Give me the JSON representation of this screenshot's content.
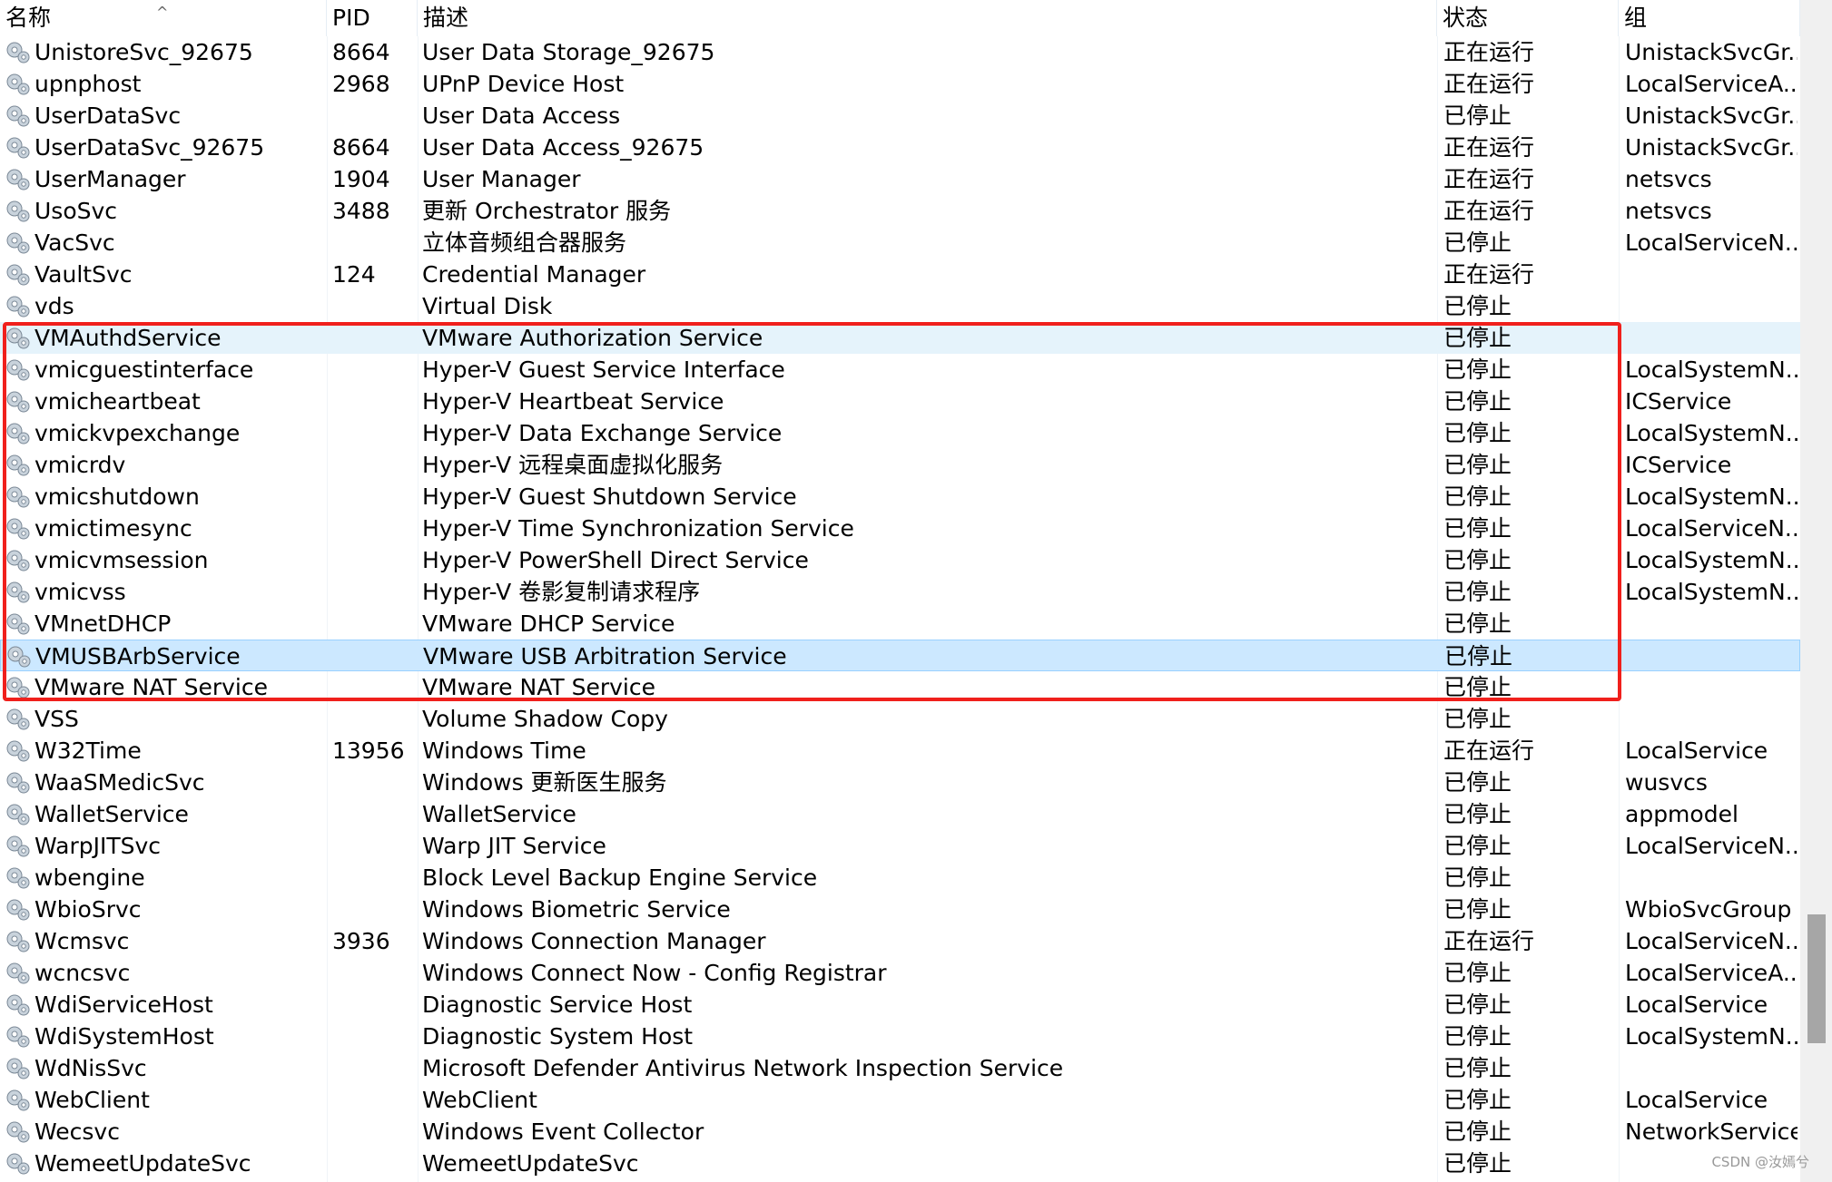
{
  "columns": {
    "name": "名称",
    "pid": "PID",
    "desc": "描述",
    "status": "状态",
    "group": "组"
  },
  "sort_indicator": "^",
  "highlight_color": "#f0201c",
  "rows": [
    {
      "name": "UnistoreSvc_92675",
      "pid": "8664",
      "desc": "User Data Storage_92675",
      "status": "正在运行",
      "group": "UnistackSvcGr..."
    },
    {
      "name": "upnphost",
      "pid": "2968",
      "desc": "UPnP Device Host",
      "status": "正在运行",
      "group": "LocalServiceA..."
    },
    {
      "name": "UserDataSvc",
      "pid": "",
      "desc": "User Data Access",
      "status": "已停止",
      "group": "UnistackSvcGr..."
    },
    {
      "name": "UserDataSvc_92675",
      "pid": "8664",
      "desc": "User Data Access_92675",
      "status": "正在运行",
      "group": "UnistackSvcGr..."
    },
    {
      "name": "UserManager",
      "pid": "1904",
      "desc": "User Manager",
      "status": "正在运行",
      "group": "netsvcs"
    },
    {
      "name": "UsoSvc",
      "pid": "3488",
      "desc": "更新 Orchestrator 服务",
      "status": "正在运行",
      "group": "netsvcs"
    },
    {
      "name": "VacSvc",
      "pid": "",
      "desc": "立体音频组合器服务",
      "status": "已停止",
      "group": "LocalServiceN..."
    },
    {
      "name": "VaultSvc",
      "pid": "124",
      "desc": "Credential Manager",
      "status": "正在运行",
      "group": ""
    },
    {
      "name": "vds",
      "pid": "",
      "desc": "Virtual Disk",
      "status": "已停止",
      "group": ""
    },
    {
      "name": "VMAuthdService",
      "pid": "",
      "desc": "VMware Authorization Service",
      "status": "已停止",
      "group": "",
      "state": "hover"
    },
    {
      "name": "vmicguestinterface",
      "pid": "",
      "desc": "Hyper-V Guest Service Interface",
      "status": "已停止",
      "group": "LocalSystemN..."
    },
    {
      "name": "vmicheartbeat",
      "pid": "",
      "desc": "Hyper-V Heartbeat Service",
      "status": "已停止",
      "group": "ICService"
    },
    {
      "name": "vmickvpexchange",
      "pid": "",
      "desc": "Hyper-V Data Exchange Service",
      "status": "已停止",
      "group": "LocalSystemN..."
    },
    {
      "name": "vmicrdv",
      "pid": "",
      "desc": "Hyper-V 远程桌面虚拟化服务",
      "status": "已停止",
      "group": "ICService"
    },
    {
      "name": "vmicshutdown",
      "pid": "",
      "desc": "Hyper-V Guest Shutdown Service",
      "status": "已停止",
      "group": "LocalSystemN..."
    },
    {
      "name": "vmictimesync",
      "pid": "",
      "desc": "Hyper-V Time Synchronization Service",
      "status": "已停止",
      "group": "LocalServiceN..."
    },
    {
      "name": "vmicvmsession",
      "pid": "",
      "desc": "Hyper-V PowerShell Direct Service",
      "status": "已停止",
      "group": "LocalSystemN..."
    },
    {
      "name": "vmicvss",
      "pid": "",
      "desc": "Hyper-V 卷影复制请求程序",
      "status": "已停止",
      "group": "LocalSystemN..."
    },
    {
      "name": "VMnetDHCP",
      "pid": "",
      "desc": "VMware DHCP Service",
      "status": "已停止",
      "group": ""
    },
    {
      "name": "VMUSBArbService",
      "pid": "",
      "desc": "VMware USB Arbitration Service",
      "status": "已停止",
      "group": "",
      "state": "selected"
    },
    {
      "name": "VMware NAT Service",
      "pid": "",
      "desc": "VMware NAT Service",
      "status": "已停止",
      "group": ""
    },
    {
      "name": "VSS",
      "pid": "",
      "desc": "Volume Shadow Copy",
      "status": "已停止",
      "group": ""
    },
    {
      "name": "W32Time",
      "pid": "13956",
      "desc": "Windows Time",
      "status": "正在运行",
      "group": "LocalService"
    },
    {
      "name": "WaaSMedicSvc",
      "pid": "",
      "desc": "Windows 更新医生服务",
      "status": "已停止",
      "group": "wusvcs"
    },
    {
      "name": "WalletService",
      "pid": "",
      "desc": "WalletService",
      "status": "已停止",
      "group": "appmodel"
    },
    {
      "name": "WarpJITSvc",
      "pid": "",
      "desc": "Warp JIT Service",
      "status": "已停止",
      "group": "LocalServiceN..."
    },
    {
      "name": "wbengine",
      "pid": "",
      "desc": "Block Level Backup Engine Service",
      "status": "已停止",
      "group": ""
    },
    {
      "name": "WbioSrvc",
      "pid": "",
      "desc": "Windows Biometric Service",
      "status": "已停止",
      "group": "WbioSvcGroup"
    },
    {
      "name": "Wcmsvc",
      "pid": "3936",
      "desc": "Windows Connection Manager",
      "status": "正在运行",
      "group": "LocalServiceN..."
    },
    {
      "name": "wcncsvc",
      "pid": "",
      "desc": "Windows Connect Now - Config Registrar",
      "status": "已停止",
      "group": "LocalServiceA..."
    },
    {
      "name": "WdiServiceHost",
      "pid": "",
      "desc": "Diagnostic Service Host",
      "status": "已停止",
      "group": "LocalService"
    },
    {
      "name": "WdiSystemHost",
      "pid": "",
      "desc": "Diagnostic System Host",
      "status": "已停止",
      "group": "LocalSystemN..."
    },
    {
      "name": "WdNisSvc",
      "pid": "",
      "desc": "Microsoft Defender Antivirus Network Inspection Service",
      "status": "已停止",
      "group": ""
    },
    {
      "name": "WebClient",
      "pid": "",
      "desc": "WebClient",
      "status": "已停止",
      "group": "LocalService"
    },
    {
      "name": "Wecsvc",
      "pid": "",
      "desc": "Windows Event Collector",
      "status": "已停止",
      "group": "NetworkService"
    },
    {
      "name": "WemeetUpdateSvc",
      "pid": "",
      "desc": "WemeetUpdateSvc",
      "status": "已停止",
      "group": ""
    }
  ],
  "watermark": "CSDN @汝嫣兮"
}
